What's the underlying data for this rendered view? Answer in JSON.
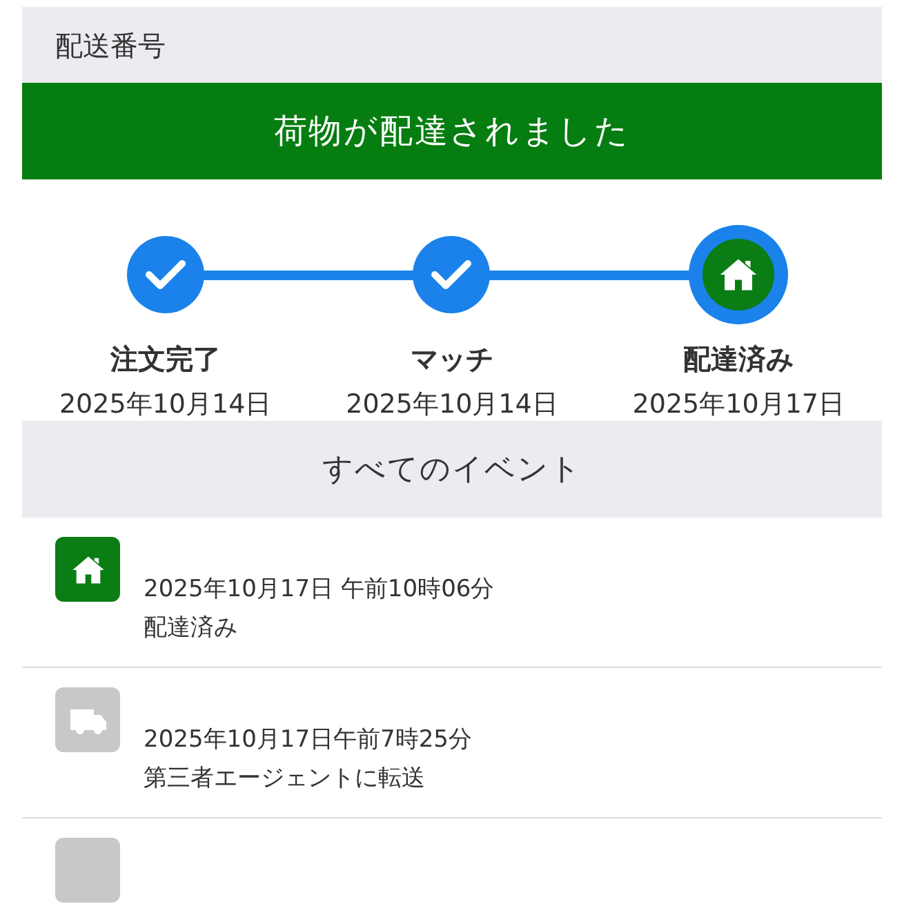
{
  "header": {
    "label": "配送番号"
  },
  "banner": {
    "text": "荷物が配達されました"
  },
  "steps": [
    {
      "kind": "check",
      "label": "注文完了",
      "date": "2025年10月14日"
    },
    {
      "kind": "check",
      "label": "マッチ",
      "date": "2025年10月14日"
    },
    {
      "kind": "home",
      "label": "配達済み",
      "date": "2025年10月17日"
    }
  ],
  "events_header": {
    "title": "すべてのイベント"
  },
  "events": [
    {
      "kind": "home",
      "time": "2025年10月17日 午前10時06分",
      "description": "配達済み"
    },
    {
      "kind": "truck",
      "time": "2025年10月17日午前7時25分",
      "description": "第三者エージェントに転送"
    },
    {
      "kind": "blank"
    }
  ]
}
